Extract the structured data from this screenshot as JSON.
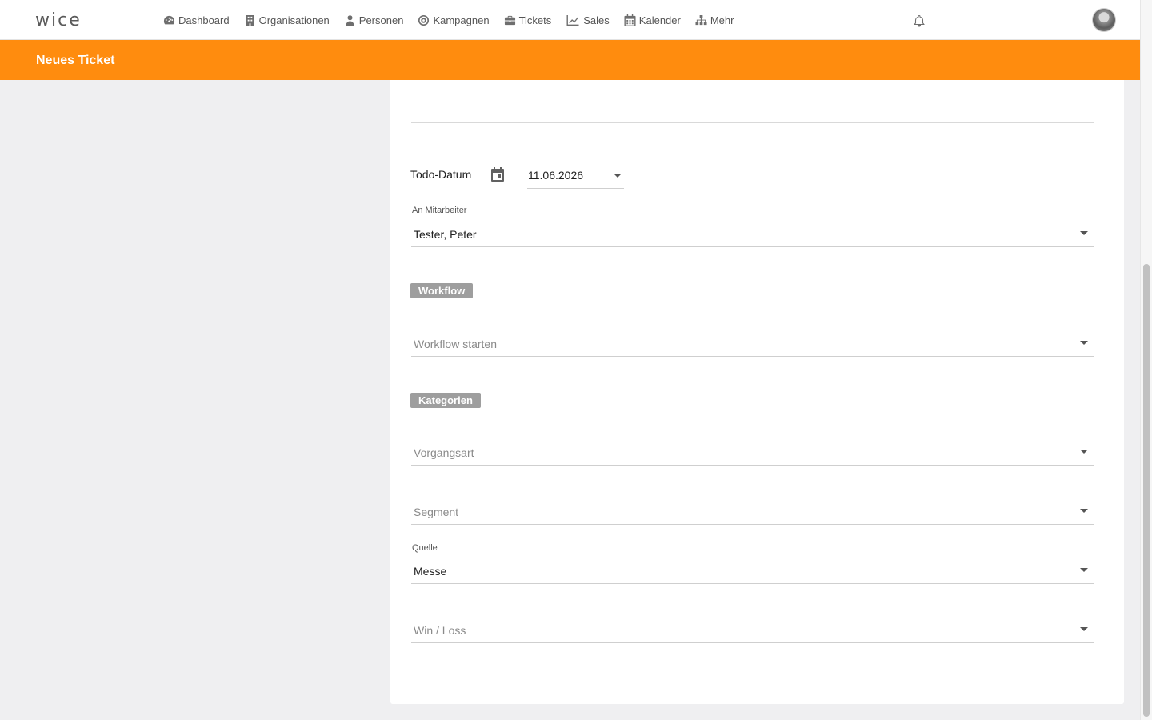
{
  "app": {
    "logo_text": "wice"
  },
  "nav": {
    "items": [
      {
        "label": "Dashboard",
        "icon": "dashboard-icon"
      },
      {
        "label": "Organisationen",
        "icon": "building-icon"
      },
      {
        "label": "Personen",
        "icon": "person-icon"
      },
      {
        "label": "Kampagnen",
        "icon": "target-icon"
      },
      {
        "label": "Tickets",
        "icon": "briefcase-icon"
      },
      {
        "label": "Sales",
        "icon": "line-chart-icon"
      },
      {
        "label": "Kalender",
        "icon": "calendar-icon"
      },
      {
        "label": "Mehr",
        "icon": "sitemap-icon"
      }
    ],
    "notification_icon": "bell-icon",
    "avatar_icon": "user-avatar"
  },
  "header": {
    "title": "Neues Ticket"
  },
  "form": {
    "todo_date": {
      "label": "Todo-Datum",
      "value": "11.06.2026"
    },
    "assignee": {
      "label": "An Mitarbeiter",
      "value": "Tester, Peter"
    },
    "workflow_section": "Workflow",
    "workflow_select": {
      "placeholder": "Workflow starten"
    },
    "categories_section": "Kategorien",
    "vorgangsart": {
      "placeholder": "Vorgangsart"
    },
    "segment": {
      "placeholder": "Segment"
    },
    "quelle": {
      "label": "Quelle",
      "value": "Messe"
    },
    "win_loss": {
      "placeholder": "Win / Loss"
    }
  },
  "colors": {
    "accent": "#ff8c0e",
    "chip": "#9e9e9e",
    "background": "#efeff1"
  }
}
